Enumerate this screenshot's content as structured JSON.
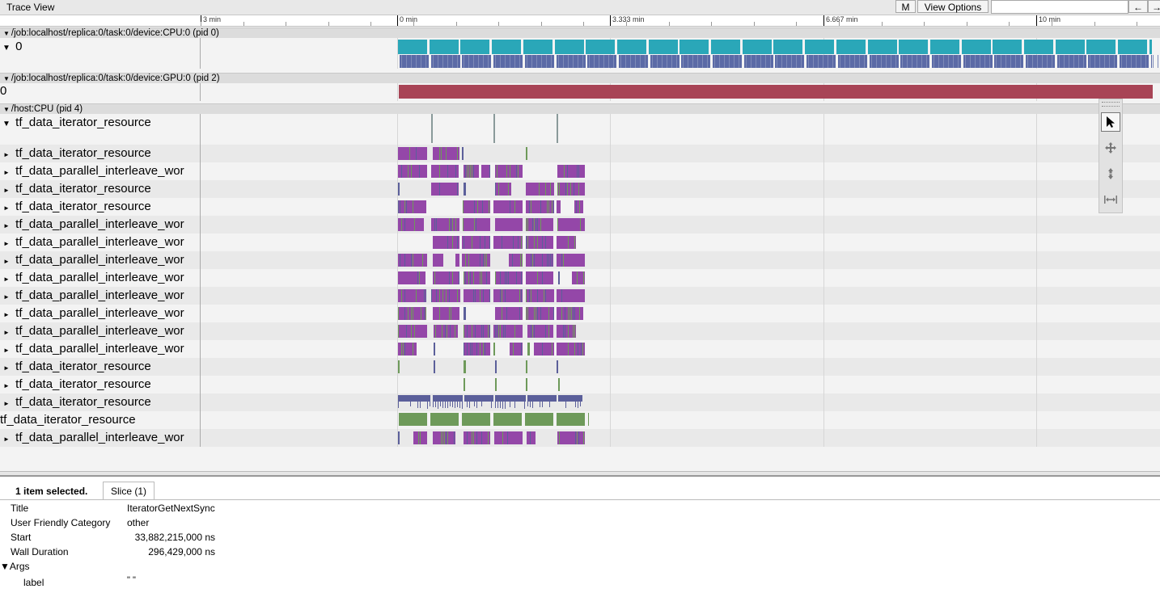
{
  "app": {
    "title": "Trace View"
  },
  "toolbar": {
    "m_label": "M",
    "view_options_label": "View Options ▾",
    "search_placeholder": "",
    "prev_label": "←",
    "next_label": "→"
  },
  "ruler": {
    "ticks": [
      "3 min",
      "0 min",
      "3.333 min",
      "6.667 min",
      "10 min"
    ]
  },
  "processes": [
    {
      "label": "/job:localhost/replica:0/task:0/device:CPU:0 (pid 0)"
    },
    {
      "label": "/job:localhost/replica:0/task:0/device:GPU:0 (pid 2)"
    },
    {
      "label": "/host:CPU (pid 4)"
    }
  ],
  "cpu_thread_label": "0",
  "gpu_thread_label": "0",
  "host_threads": [
    "tf_data_iterator_resource",
    "tf_data_iterator_resource",
    "tf_data_parallel_interleave_wor",
    "tf_data_iterator_resource",
    "tf_data_iterator_resource",
    "tf_data_parallel_interleave_wor",
    "tf_data_parallel_interleave_wor",
    "tf_data_parallel_interleave_wor",
    "tf_data_parallel_interleave_wor",
    "tf_data_parallel_interleave_wor",
    "tf_data_parallel_interleave_wor",
    "tf_data_parallel_interleave_wor",
    "tf_data_parallel_interleave_wor",
    "tf_data_iterator_resource",
    "tf_data_iterator_resource",
    "tf_data_iterator_resource",
    "tf_data_iterator_resource",
    "tf_data_parallel_interleave_wor"
  ],
  "colors": {
    "cpu_top": "#2aa7b8",
    "cpu_bottom": "#5b6aa6",
    "gpu": "#a84456",
    "purple": "#9447a8",
    "green": "#6e9a5a",
    "slate": "#5b5f9a"
  },
  "tools": [
    "pointer-icon",
    "pan-icon",
    "zoom-icon",
    "timing-icon"
  ],
  "details": {
    "selection_text": "1 item selected.",
    "tab_label": "Slice (1)",
    "rows": [
      {
        "key": "Title",
        "value": "IteratorGetNextSync"
      },
      {
        "key": "User Friendly Category",
        "value": "other"
      },
      {
        "key": "Start",
        "value": "33,882,215,000 ns"
      },
      {
        "key": "Wall Duration",
        "value": "296,429,000 ns"
      }
    ],
    "args_label": "▼Args",
    "arg_key": "label",
    "arg_value": "\" \""
  }
}
